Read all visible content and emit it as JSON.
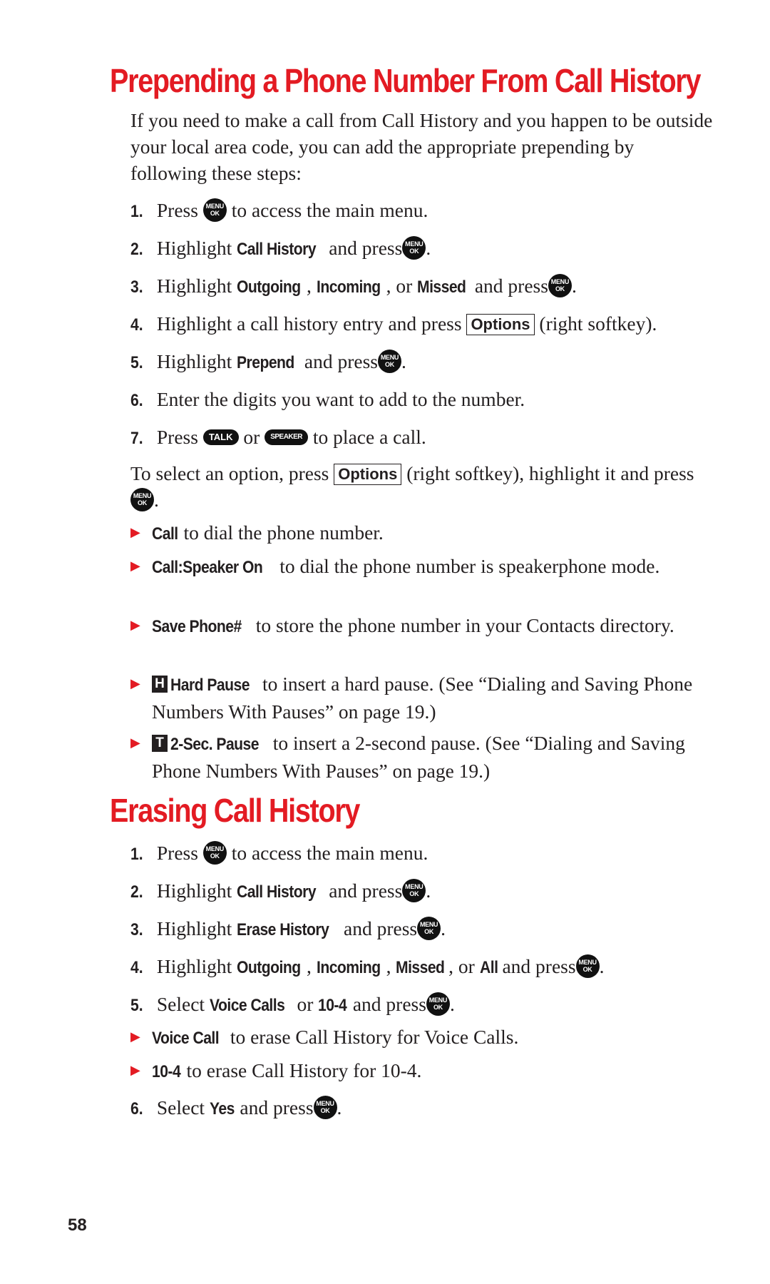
{
  "sections": [
    {
      "title": "Prependin​g a Phone Number From Call History",
      "intro": "If you need to make a call from Call History and you happen to be outside your local area code, you can add the appropriate prepending by following these steps:",
      "steps": [
        {
          "num": "1.",
          "t1": "Press",
          "t2": "to access the main menu."
        },
        {
          "num": "2.",
          "t1": "Highlight",
          "b1": "Call History",
          "t2": "and press",
          "t3": "."
        },
        {
          "num": "3.",
          "t1": "Highlight",
          "b1": "Outgoing",
          "t2": ",",
          "b2": "Incoming",
          "t3": ", or",
          "b3": "Missed",
          "t4": "and press",
          "t5": "."
        },
        {
          "num": "4.",
          "t1": "Highlight a call history entry and press",
          "softkey": "Options",
          "t2": "(right softkey)."
        },
        {
          "num": "5.",
          "t1": "Highlight",
          "b1": "Prepend",
          "t2": "and press",
          "t3": "."
        },
        {
          "num": "6.",
          "t1": "Enter the digits you want to add to the number."
        },
        {
          "num": "7.",
          "t1": "Press",
          "key1": "TALK",
          "t2": "or",
          "key2": "SPEAKER",
          "t3": "to place a call."
        }
      ],
      "options_intro": {
        "t1": "To select an option, press",
        "softkey": "Options",
        "t2": "(right softkey), highlight it and press",
        "t3": "."
      },
      "options": [
        {
          "label": "Call",
          "text": "to dial the phone number."
        },
        {
          "label": "Call:Speaker On",
          "text": "to dial the phone number is speakerphone mode."
        },
        {
          "label": "Save Phone#",
          "text": "to store the phone number in your Contacts directory."
        },
        {
          "icon_letter": "H",
          "label": "Hard Pause",
          "text": "to insert a hard pause. (See “Dialing and Saving Phone Numbers With Pauses” on page 19.)"
        },
        {
          "icon_letter": "T",
          "label": "2-Sec. Pause",
          "text": "to insert a 2-second pause. (See “Dialing and Saving Phone Numbers With Pauses” on page 19.)"
        }
      ]
    },
    {
      "title": "Erasing Call History",
      "steps": [
        {
          "num": "1.",
          "t1": "Press",
          "t2": "to access the main menu."
        },
        {
          "num": "2.",
          "t1": "Highlight",
          "b1": "Call History",
          "t2": "and press",
          "t3": "."
        },
        {
          "num": "3.",
          "t1": "Highlight",
          "b1": "Erase History",
          "t2": "and press",
          "t3": "."
        },
        {
          "num": "4.",
          "t1": "Highlight",
          "b1": "Outgoing",
          "t2": ",",
          "b2": "Incoming",
          "t3": ",",
          "b3": "Missed",
          "t4": ", or",
          "b4": "All",
          "t5": "and press",
          "t6": "."
        },
        {
          "num": "5.",
          "t1": "Select",
          "b1": "Voice Calls",
          "t2": "or",
          "b2": "10-4",
          "t3": "and press",
          "t4": "."
        },
        {
          "num": "6.",
          "t1": "Select",
          "b1": "Yes",
          "t2": "and press",
          "t3": "."
        }
      ],
      "options": [
        {
          "label": "Voice Call",
          "text": "to erase Call History for Voice Calls."
        },
        {
          "label": "10-4",
          "text": "to erase Call History for 10-4."
        }
      ]
    }
  ],
  "menu_key": {
    "line1": "MENU",
    "line2": "OK"
  },
  "colors": {
    "heading": "#e31b23",
    "bullet": "#e31b23",
    "text": "#231f20"
  },
  "page_number": "58"
}
